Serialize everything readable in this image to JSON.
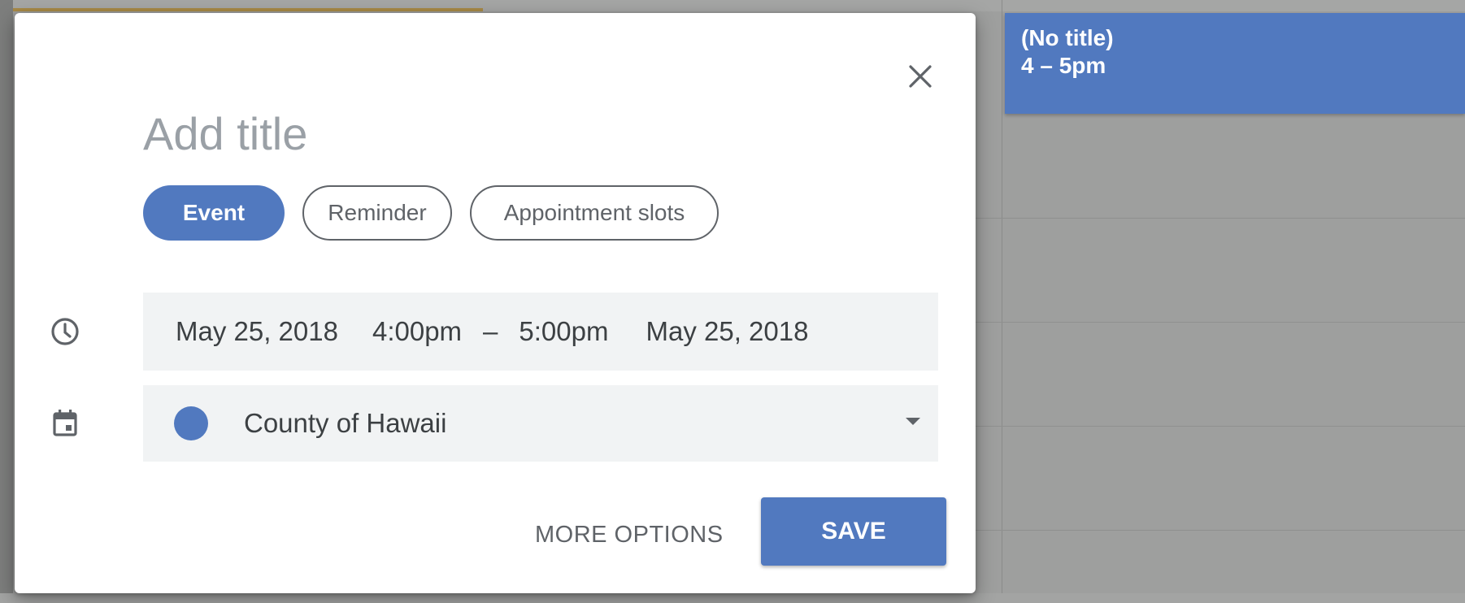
{
  "dialog": {
    "title_placeholder": "Add title",
    "types": [
      {
        "label": "Event",
        "active": true
      },
      {
        "label": "Reminder",
        "active": false
      },
      {
        "label": "Appointment slots",
        "active": false
      }
    ],
    "time": {
      "start_date": "May 25, 2018",
      "start_time": "4:00pm",
      "separator": "–",
      "end_time": "5:00pm",
      "end_date": "May 25, 2018"
    },
    "calendar": {
      "name": "County of Hawaii",
      "color": "#5179bf"
    },
    "actions": {
      "more_options": "MORE OPTIONS",
      "save": "SAVE"
    }
  },
  "event_chip": {
    "title": "(No title)",
    "time": "4 – 5pm"
  },
  "colors": {
    "accent": "#5179bf",
    "overlay": "#9e9f9e"
  },
  "icons": {
    "close": "close-icon",
    "time": "clock-icon",
    "calendar": "calendar-icon",
    "dropdown": "dropdown-caret-icon"
  }
}
